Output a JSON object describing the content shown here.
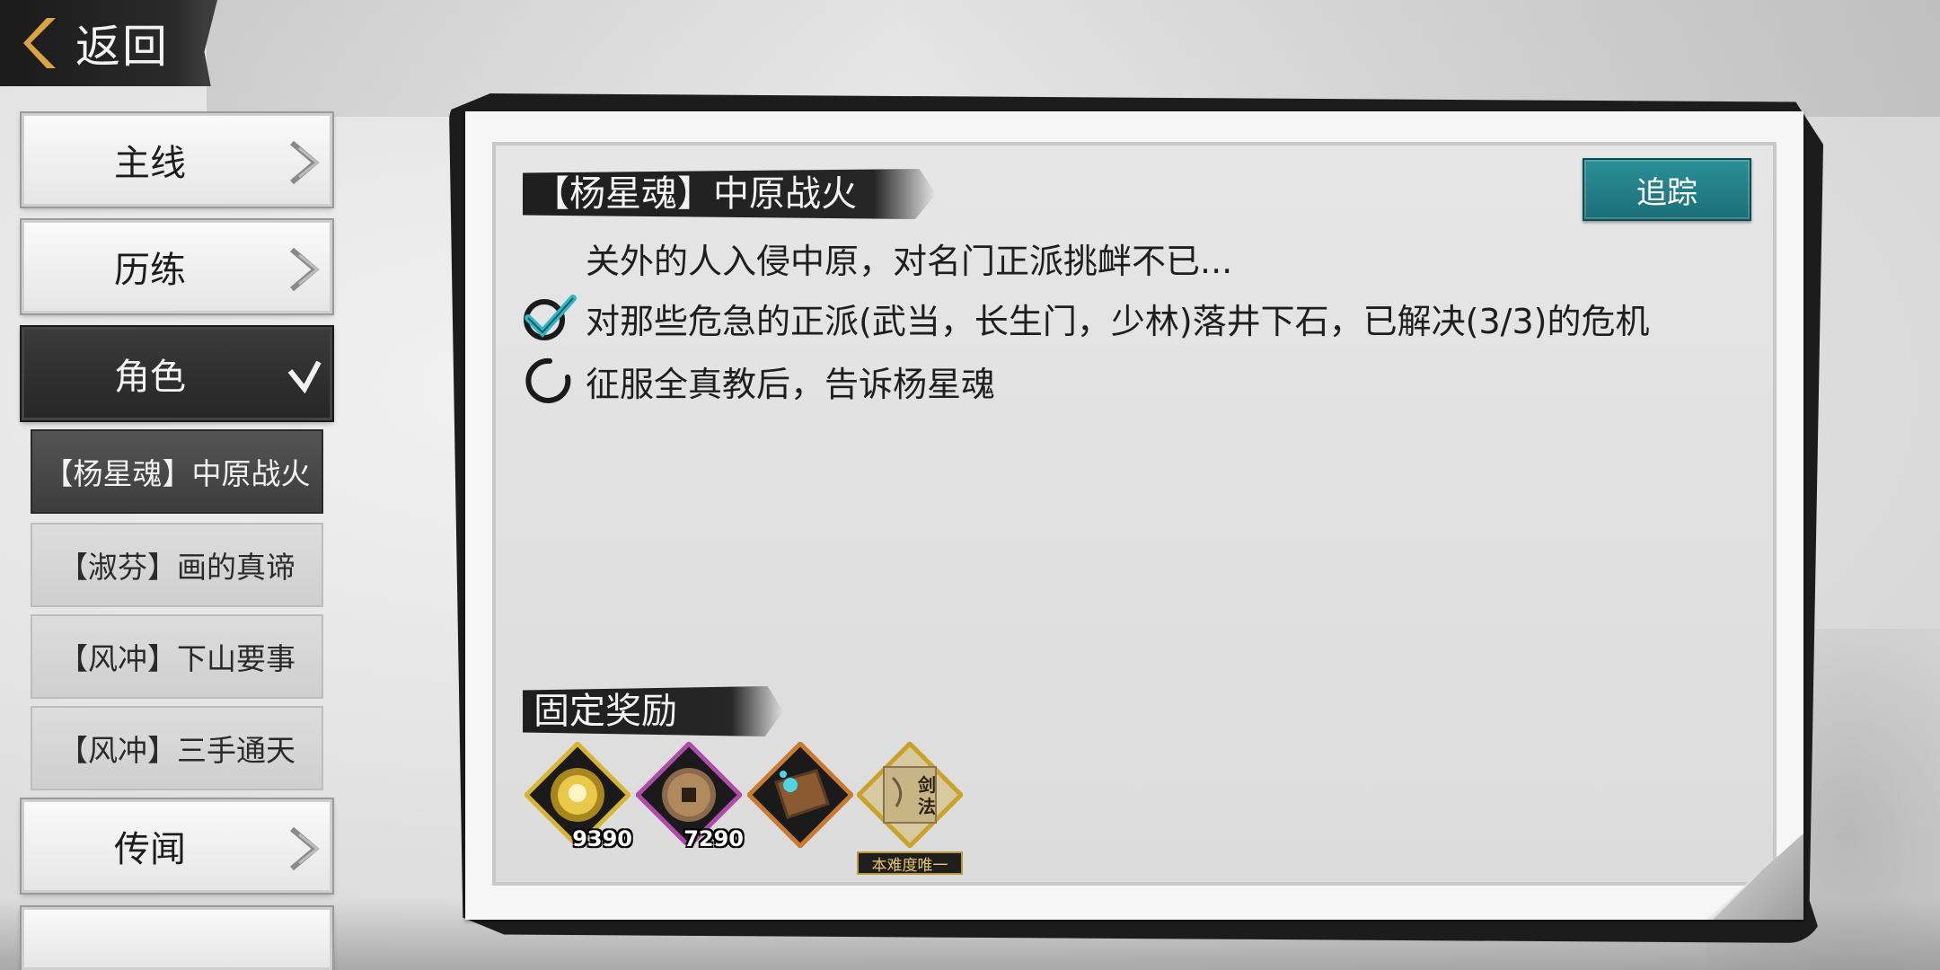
{
  "back": {
    "label": "返回"
  },
  "sidebar": {
    "categories": [
      {
        "label": "主线"
      },
      {
        "label": "历练"
      },
      {
        "label": "角色"
      },
      {
        "label": "传闻"
      }
    ],
    "quests": [
      {
        "label": "【杨星魂】中原战火",
        "selected": true
      },
      {
        "label": "【淑芬】画的真谛"
      },
      {
        "label": "【风冲】下山要事"
      },
      {
        "label": "【风冲】三手通天"
      }
    ]
  },
  "quest": {
    "title": "【杨星魂】中原战火",
    "track_label": "追踪",
    "description": "关外的人入侵中原，对名门正派挑衅不已...",
    "objectives": [
      {
        "text": "对那些危急的正派(武当，长生门，少林)落井下石，已解决(3/3)的危机",
        "status": "done"
      },
      {
        "text": "征服全真教后，告诉杨星魂",
        "status": "in-progress"
      }
    ],
    "rewards_title": "固定奖励",
    "rewards": [
      {
        "icon": "gold-orb-icon",
        "count": "9390"
      },
      {
        "icon": "copper-coin-icon",
        "count": "7290"
      },
      {
        "icon": "skill-book-icon"
      },
      {
        "icon": "sword-manual-scroll-icon",
        "tag": "本难度唯一",
        "tag_label": "剑法"
      }
    ]
  },
  "colors": {
    "track_button": "#1f7f88",
    "reward_gold": "#c9a227",
    "reward_purple": "#a23d9e",
    "check_teal": "#2fb7c4"
  }
}
